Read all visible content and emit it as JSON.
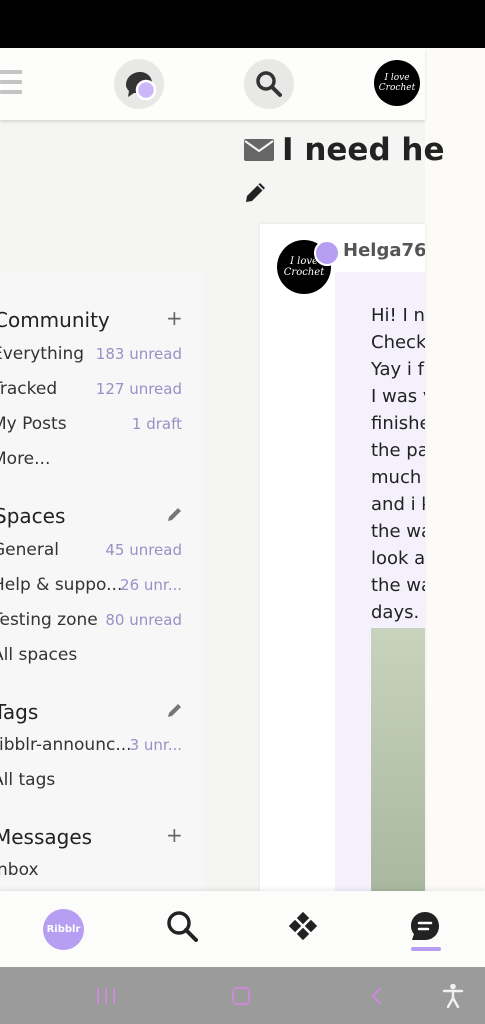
{
  "header": {
    "avatar_text": "I love Crochet"
  },
  "topic": {
    "title": "I need he"
  },
  "post": {
    "username": "Helga76",
    "avatar_text": "I love Crochet",
    "lines": [
      "Hi! I ne",
      "Check",
      "Yay i f",
      "I was v",
      "finishe",
      "the pa",
      "much",
      "and i k",
      "the wa",
      "look a",
      "the wa",
      "days."
    ]
  },
  "sidebar": {
    "community": {
      "title": "Community",
      "items": [
        {
          "label": "Everything",
          "count": "183 unread"
        },
        {
          "label": "Tracked",
          "count": "127 unread"
        },
        {
          "label": "My Posts",
          "count": "1 draft"
        },
        {
          "label": "More...",
          "count": ""
        }
      ]
    },
    "spaces": {
      "title": "Spaces",
      "items": [
        {
          "label": "General",
          "count": "45 unread"
        },
        {
          "label": "Help & suppo...",
          "count": "26 unr..."
        },
        {
          "label": "Testing zone",
          "count": "80 unread"
        },
        {
          "label": "All spaces",
          "count": ""
        }
      ]
    },
    "tags": {
      "title": "Tags",
      "items": [
        {
          "label": "ribblr-announc...",
          "count": "3 unr..."
        },
        {
          "label": "All tags",
          "count": ""
        }
      ]
    },
    "messages": {
      "title": "Messages",
      "items": [
        {
          "label": "Inbox",
          "count": ""
        }
      ]
    }
  },
  "bottom_nav": {
    "logo_text": "Ribblr"
  },
  "colors": {
    "accent": "#b69ef2",
    "count_text": "#9b8fc7",
    "system_nav_icons": "#c98ad8"
  }
}
